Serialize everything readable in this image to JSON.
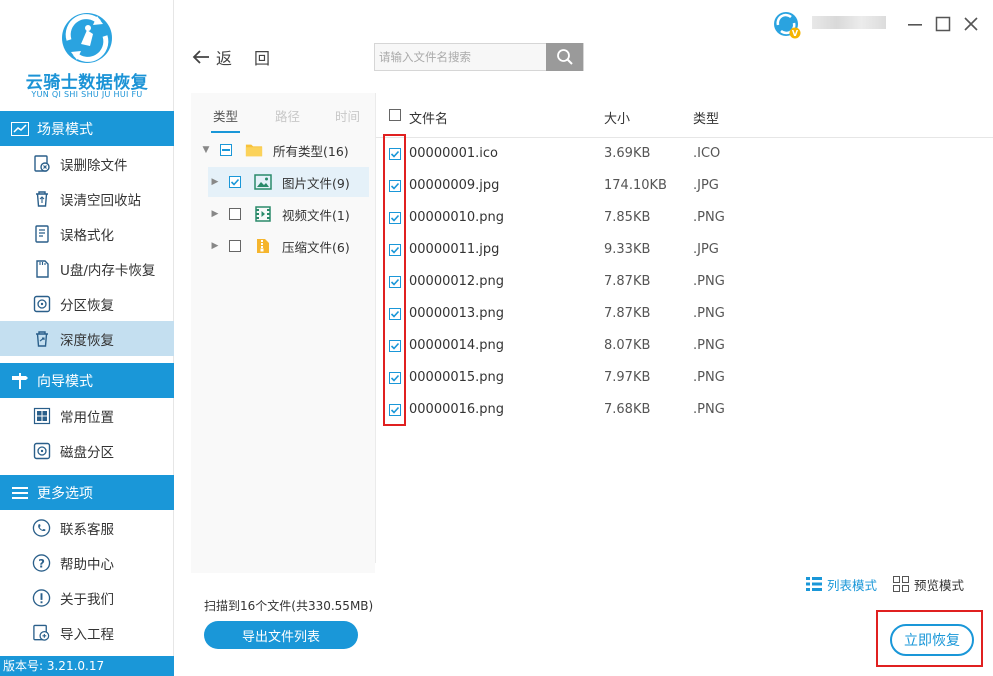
{
  "app": {
    "logo_title": "云骑士数据恢复",
    "logo_subtitle": "YUN QI SHI SHU JU HUI FU",
    "version": "版本号: 3.21.0.17"
  },
  "sidebar": {
    "sections": [
      {
        "title": "场景模式",
        "icon": "chart-icon",
        "items": [
          {
            "label": "误删除文件",
            "icon": "deleted-file-icon"
          },
          {
            "label": "误清空回收站",
            "icon": "recycle-bin-icon"
          },
          {
            "label": "误格式化",
            "icon": "format-icon"
          },
          {
            "label": "U盘/内存卡恢复",
            "icon": "sd-card-icon"
          },
          {
            "label": "分区恢复",
            "icon": "partition-icon"
          },
          {
            "label": "深度恢复",
            "icon": "deep-recover-icon",
            "active": true
          }
        ]
      },
      {
        "title": "向导模式",
        "icon": "signpost-icon",
        "items": [
          {
            "label": "常用位置",
            "icon": "windows-icon"
          },
          {
            "label": "磁盘分区",
            "icon": "disk-icon"
          }
        ]
      },
      {
        "title": "更多选项",
        "icon": "menu-icon",
        "items": [
          {
            "label": "联系客服",
            "icon": "phone-icon"
          },
          {
            "label": "帮助中心",
            "icon": "help-icon"
          },
          {
            "label": "关于我们",
            "icon": "info-icon"
          },
          {
            "label": "导入工程",
            "icon": "import-icon"
          }
        ]
      }
    ]
  },
  "toolbar": {
    "back_label": "返回",
    "search_placeholder": "请输入文件名搜索"
  },
  "filter": {
    "tabs": [
      "类型",
      "路径",
      "时间"
    ],
    "active_tab": "类型",
    "tree": [
      {
        "label": "所有类型(16)",
        "state": "partial",
        "icon": "folder-icon",
        "expanded": true
      },
      {
        "label": "图片文件(9)",
        "state": "checked",
        "icon": "image-icon",
        "selected": true
      },
      {
        "label": "视频文件(1)",
        "state": "unchecked",
        "icon": "video-icon"
      },
      {
        "label": "压缩文件(6)",
        "state": "unchecked",
        "icon": "zip-icon"
      }
    ]
  },
  "file_table": {
    "columns": [
      "文件名",
      "大小",
      "类型"
    ],
    "rows": [
      {
        "name": "00000001.ico",
        "size": "3.69KB",
        "type": ".ICO",
        "checked": true
      },
      {
        "name": "00000009.jpg",
        "size": "174.10KB",
        "type": ".JPG",
        "checked": true
      },
      {
        "name": "00000010.png",
        "size": "7.85KB",
        "type": ".PNG",
        "checked": true
      },
      {
        "name": "00000011.jpg",
        "size": "9.33KB",
        "type": ".JPG",
        "checked": true
      },
      {
        "name": "00000012.png",
        "size": "7.87KB",
        "type": ".PNG",
        "checked": true
      },
      {
        "name": "00000013.png",
        "size": "7.87KB",
        "type": ".PNG",
        "checked": true
      },
      {
        "name": "00000014.png",
        "size": "8.07KB",
        "type": ".PNG",
        "checked": true
      },
      {
        "name": "00000015.png",
        "size": "7.97KB",
        "type": ".PNG",
        "checked": true
      },
      {
        "name": "00000016.png",
        "size": "7.68KB",
        "type": ".PNG",
        "checked": true
      }
    ]
  },
  "view_modes": {
    "list_label": "列表模式",
    "preview_label": "预览模式",
    "active": "list"
  },
  "footer": {
    "scan_info": "扫描到16个文件(共330.55MB)",
    "export_label": "导出文件列表",
    "recover_label": "立即恢复"
  },
  "colors": {
    "accent": "#1a97d8",
    "active_nav": "#c4dff0",
    "highlight": "#e02020"
  }
}
